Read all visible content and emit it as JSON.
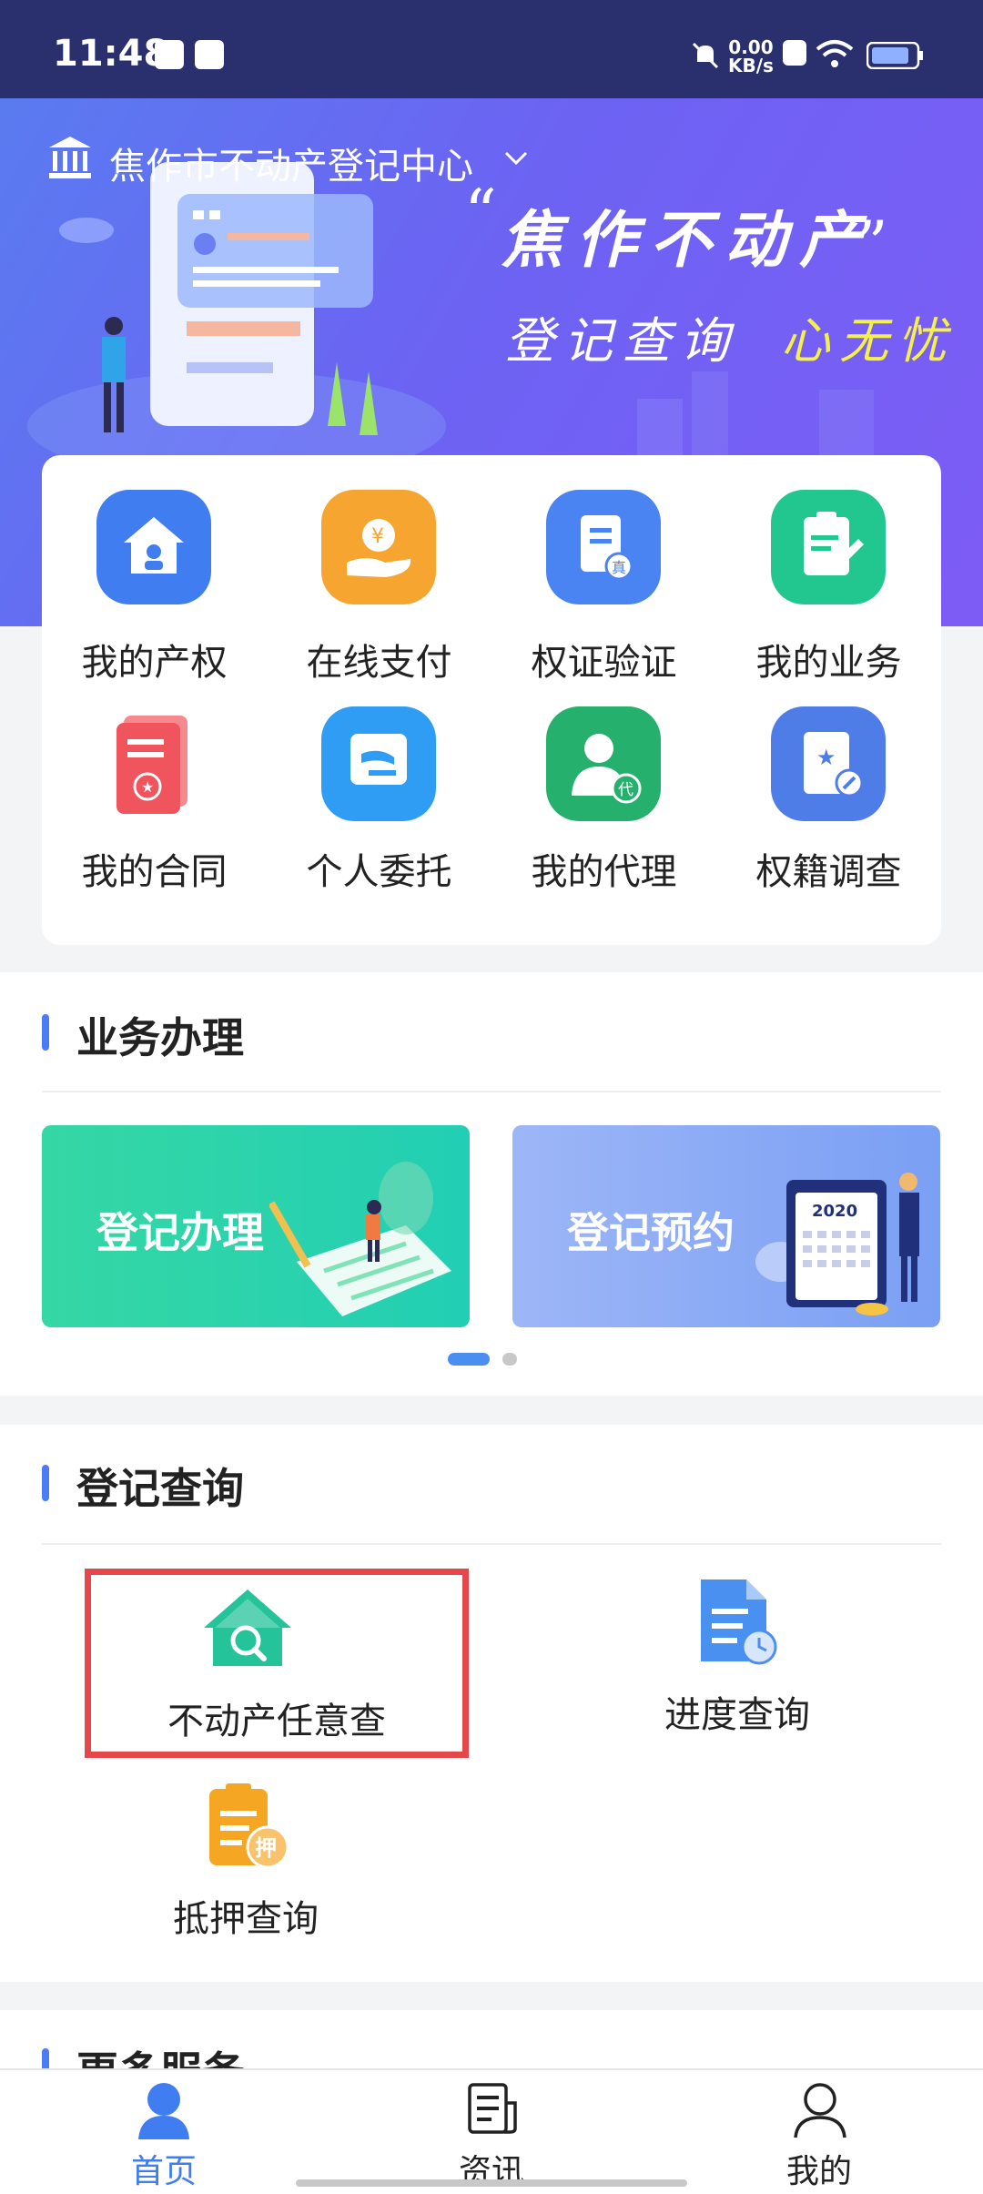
{
  "status_bar": {
    "time": "11:48",
    "net_speed_value": "0.00",
    "net_speed_unit": "KB/s"
  },
  "banner": {
    "center_name": "焦作市不动产登记中心",
    "slogan_line1": "焦作不动产",
    "slogan_line2_a": "登记查询",
    "slogan_line2_b": "心无忧"
  },
  "quick_grid": [
    {
      "label": "我的产权",
      "icon": "house-user-icon",
      "color": "#3f7df0"
    },
    {
      "label": "在线支付",
      "icon": "hand-coin-icon",
      "color": "#f7a531"
    },
    {
      "label": "权证验证",
      "icon": "certificate-verify-icon",
      "color": "#4a84f2"
    },
    {
      "label": "我的业务",
      "icon": "clipboard-edit-icon",
      "color": "#21c78e"
    },
    {
      "label": "我的合同",
      "icon": "contract-stamp-icon",
      "color": "#f0545c"
    },
    {
      "label": "个人委托",
      "icon": "hand-card-icon",
      "color": "#2f9df3"
    },
    {
      "label": "我的代理",
      "icon": "agent-person-icon",
      "color": "#25b06d"
    },
    {
      "label": "权籍调查",
      "icon": "book-star-icon",
      "color": "#4f7de8"
    }
  ],
  "business": {
    "title": "业务办理",
    "cards": [
      {
        "label": "登记办理",
        "color": "#2fd4a6"
      },
      {
        "label": "登记预约",
        "color": "#8ba8f5"
      }
    ],
    "calendar_year": "2020"
  },
  "query": {
    "title": "登记查询",
    "items": [
      {
        "label": "不动产任意查",
        "icon": "house-search-icon"
      },
      {
        "label": "进度查询",
        "icon": "document-clock-icon"
      },
      {
        "label": "抵押查询",
        "icon": "mortgage-clipboard-icon",
        "badge": "押"
      }
    ]
  },
  "more": {
    "title": "更多服务"
  },
  "tabbar": [
    {
      "label": "首页",
      "icon": "home-person-icon",
      "active": true
    },
    {
      "label": "资讯",
      "icon": "news-icon",
      "active": false
    },
    {
      "label": "我的",
      "icon": "user-icon",
      "active": false
    }
  ],
  "colors": {
    "accent": "#3f7df0",
    "highlight_border": "#e5474b",
    "banner_yellow": "#f6f14a"
  }
}
